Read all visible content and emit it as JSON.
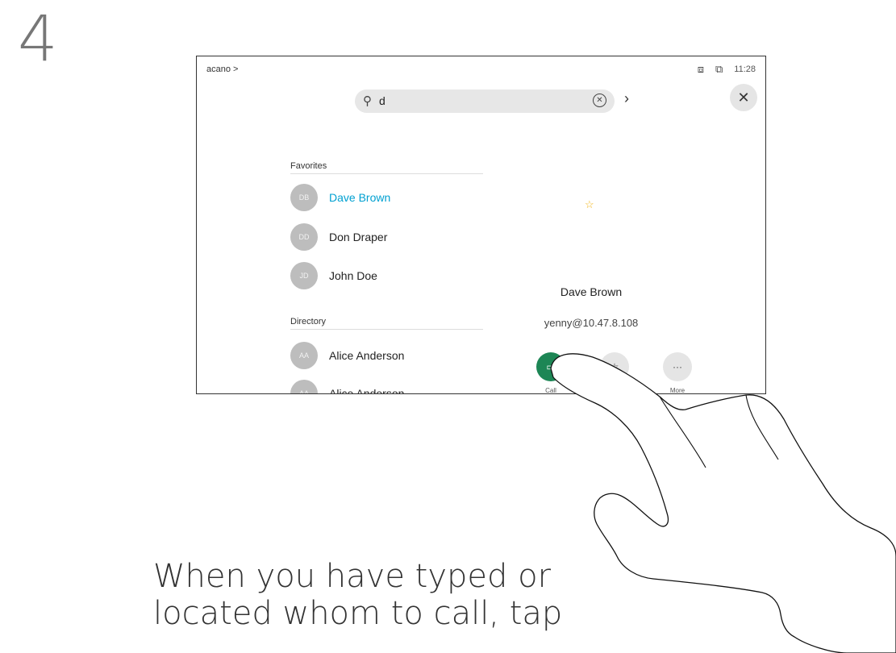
{
  "step": "4",
  "screen": {
    "breadcrumb": "acano >",
    "status": {
      "time": "11:28"
    },
    "search": {
      "query": "d"
    },
    "favorites_label": "Favorites",
    "favorites": [
      {
        "initials": "DB",
        "name": "Dave Brown",
        "selected": true
      },
      {
        "initials": "DD",
        "name": "Don Draper",
        "selected": false
      },
      {
        "initials": "JD",
        "name": "John Doe",
        "selected": false
      }
    ],
    "directory_label": "Directory",
    "directory": [
      {
        "initials": "AA",
        "name": "Alice Anderson"
      },
      {
        "initials": "AA",
        "name": "Alice Anderson"
      }
    ],
    "detail": {
      "name": "Dave Brown",
      "address": "yenny@10.47.8.108",
      "actions": [
        {
          "label": "Call"
        },
        {
          "label": ""
        },
        {
          "label": "More"
        }
      ]
    }
  },
  "caption": {
    "line1": "When you have typed or",
    "line2": "located whom to call, tap"
  },
  "colors": {
    "accent": "#00a0d1",
    "call_green": "#1d8655",
    "favorite_star": "#f2b518"
  }
}
